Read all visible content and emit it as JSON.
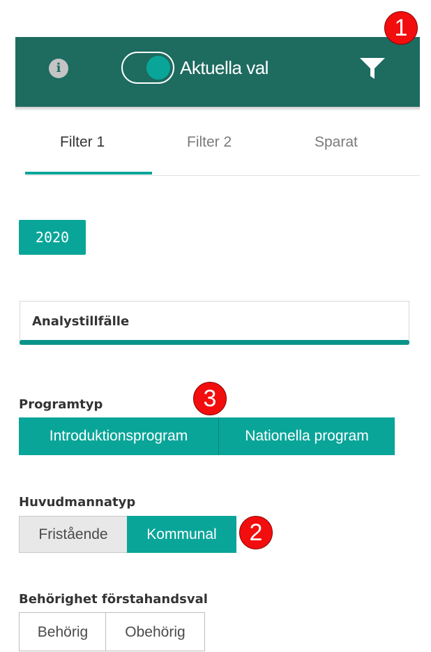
{
  "header": {
    "info_icon": "i",
    "toggle_label": "Aktuella val",
    "toggle_on": true,
    "icons": [
      "info-icon",
      "filter-icon"
    ],
    "color": "#1e6b60"
  },
  "badges": [
    "1",
    "2",
    "3"
  ],
  "tabs": [
    {
      "label": "Filter 1",
      "active": true
    },
    {
      "label": "Filter 2",
      "active": false
    },
    {
      "label": "Sparat",
      "active": false
    }
  ],
  "year_chip": "2020",
  "analys": {
    "label": "Analystillfälle"
  },
  "programtyp": {
    "label": "Programtyp",
    "options": [
      {
        "label": "Introduktionsprogram",
        "selected": true
      },
      {
        "label": "Nationella program",
        "selected": true
      }
    ]
  },
  "huvudmannatyp": {
    "label": "Huvudmannatyp",
    "options": [
      {
        "label": "Fristående",
        "selected": false
      },
      {
        "label": "Kommunal",
        "selected": true
      }
    ]
  },
  "behorighet": {
    "label": "Behörighet förstahandsval",
    "options": [
      {
        "label": "Behörig",
        "selected": false
      },
      {
        "label": "Obehörig",
        "selected": false
      }
    ]
  },
  "colors": {
    "accent": "#0aa599",
    "header": "#1e6b60",
    "badge": "#f20e0e"
  }
}
